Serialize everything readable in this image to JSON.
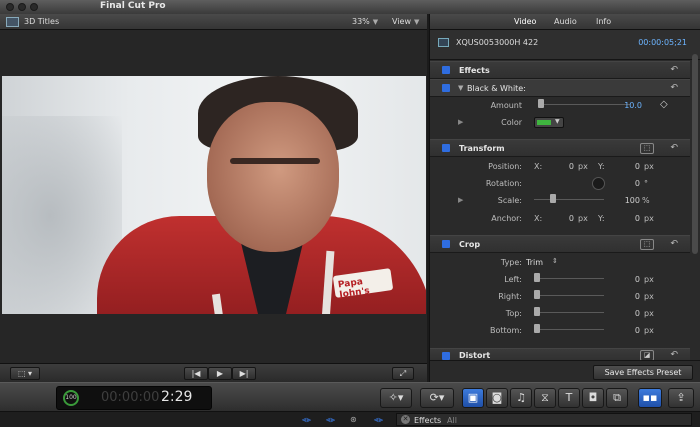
{
  "app": {
    "title": "Final Cut Pro"
  },
  "viewer": {
    "title": "3D Titles",
    "zoom": "33%",
    "view_label": "View"
  },
  "video": {
    "logo_text": "Papa John's"
  },
  "inspector": {
    "tabs": [
      "Video",
      "Audio",
      "Info"
    ],
    "clip_name": "XQUS0053000H 422",
    "timecode": "00:00:05;21",
    "effects": {
      "title": "Effects",
      "black_white": {
        "title": "Black & White:",
        "amount_label": "Amount",
        "amount_value": "10.0",
        "color_label": "Color",
        "color_swatch": "#3fb53f"
      }
    },
    "transform": {
      "title": "Transform",
      "position_label": "Position:",
      "x_label": "X:",
      "y_label": "Y:",
      "pos_x": "0",
      "pos_y": "0",
      "unit_px": "px",
      "rotation_label": "Rotation:",
      "rotation_value": "0",
      "rotation_unit": "°",
      "scale_label": "Scale:",
      "scale_value": "100",
      "scale_unit": "%",
      "anchor_label": "Anchor:",
      "anchor_x": "0",
      "anchor_y": "0"
    },
    "crop": {
      "title": "Crop",
      "type_label": "Type:",
      "type_value": "Trim",
      "left_label": "Left:",
      "left_value": "0",
      "right_label": "Right:",
      "right_value": "0",
      "top_label": "Top:",
      "top_value": "0",
      "bottom_label": "Bottom:",
      "bottom_value": "0"
    },
    "distort": {
      "title": "Distort"
    },
    "save_preset": "Save Effects Preset"
  },
  "toolbar": {
    "percent": "100",
    "timecode": "2:29",
    "ghost_digits": "00:00:00"
  },
  "status": {
    "effects_label": "Effects",
    "filter_label": "All"
  },
  "colors": {
    "accent": "#2f6de0",
    "timecode": "#6cb4ff"
  }
}
